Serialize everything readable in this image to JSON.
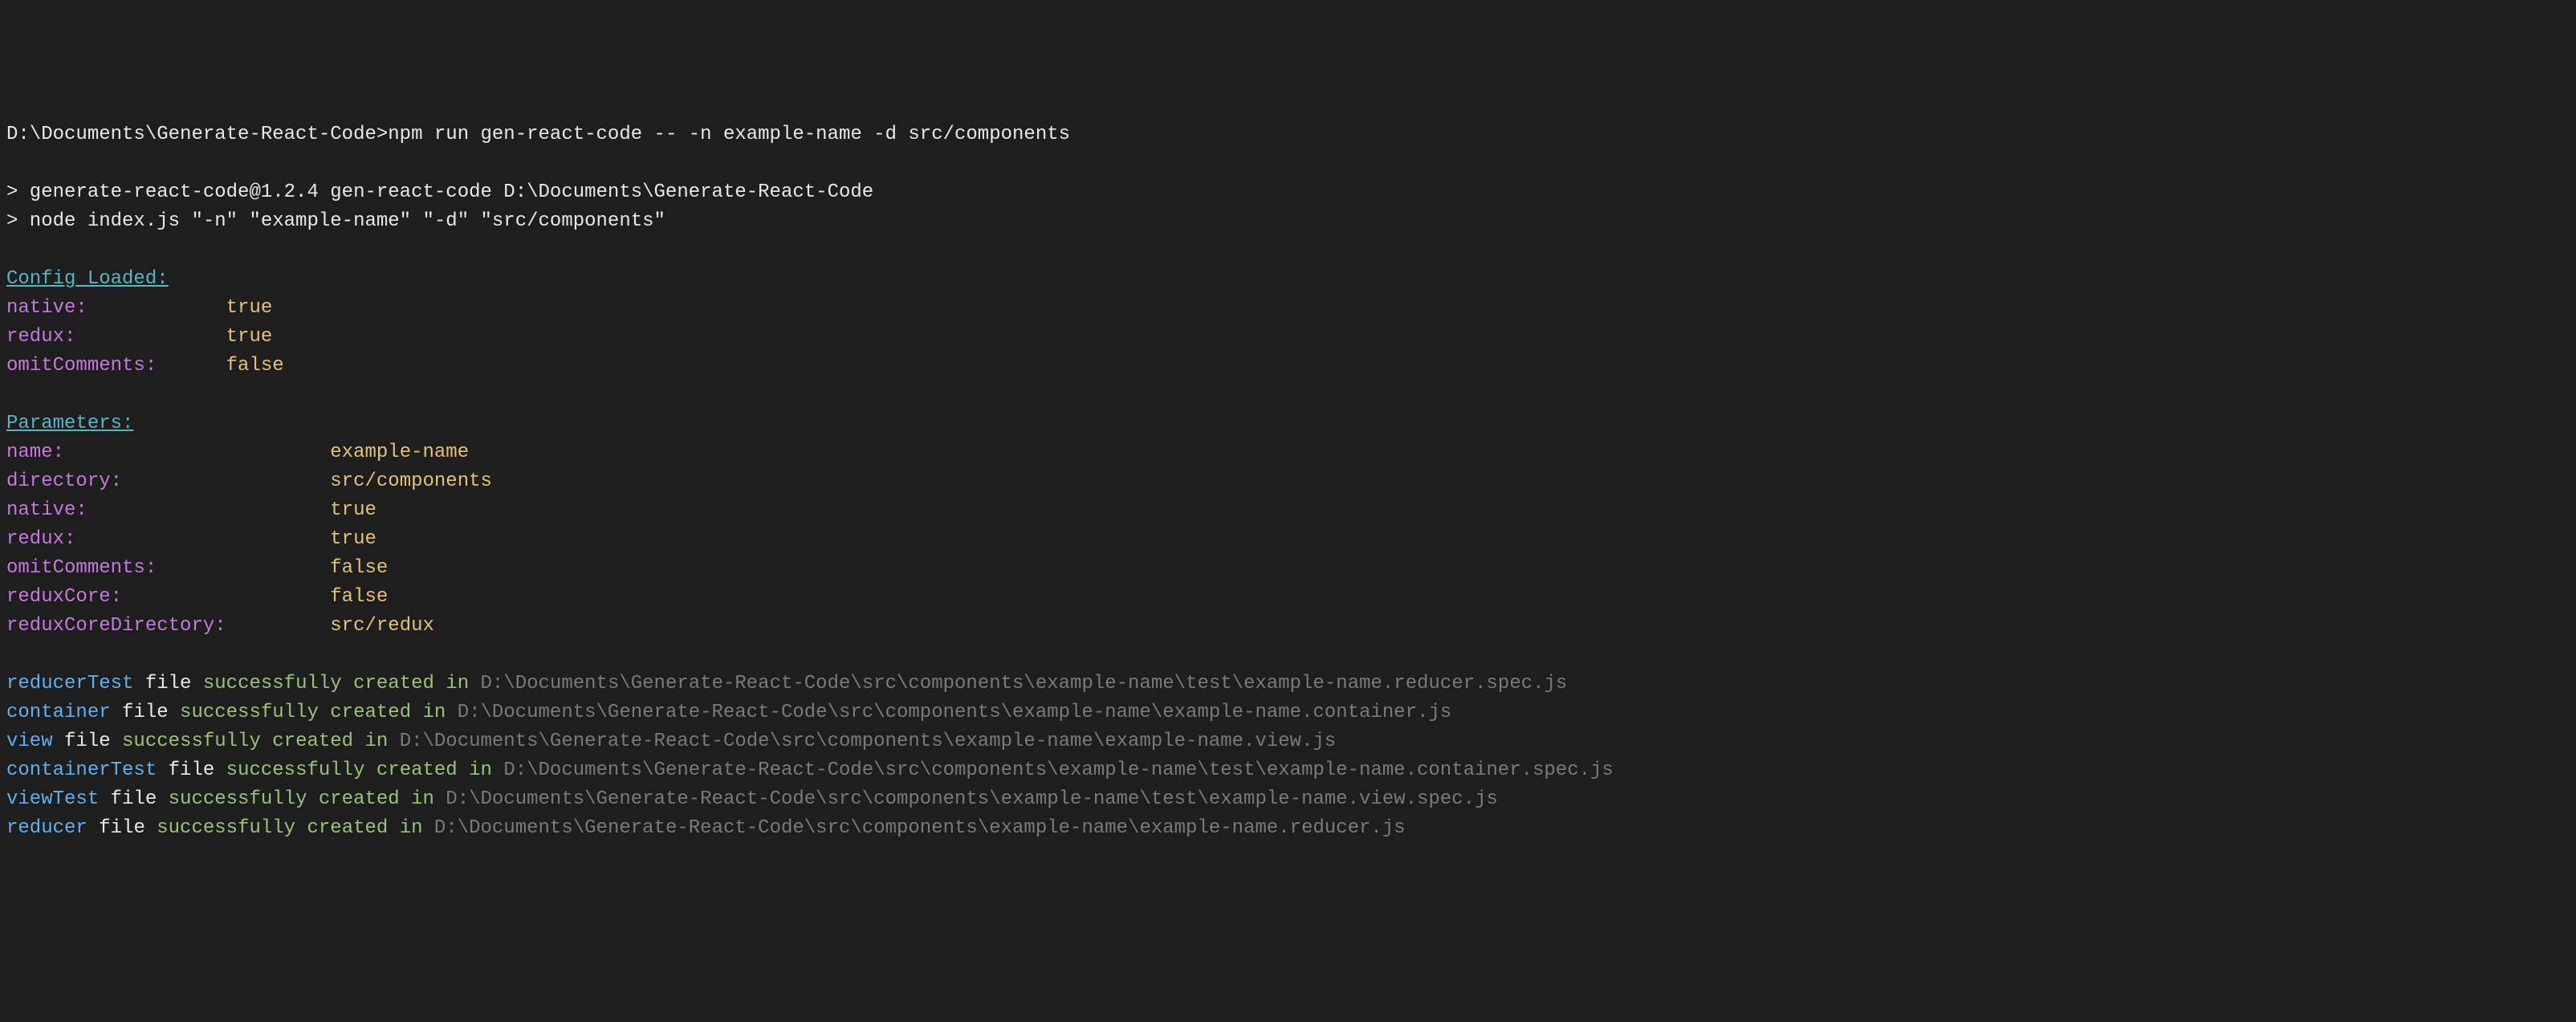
{
  "prompt": {
    "path": "D:\\Documents\\Generate-React-Code>",
    "command": "npm run gen-react-code -- -n example-name -d src/components"
  },
  "npm_output": {
    "line1": "> generate-react-code@1.2.4 gen-react-code D:\\Documents\\Generate-React-Code",
    "line2": "> node index.js \"-n\" \"example-name\" \"-d\" \"src/components\""
  },
  "config_section": {
    "header": "Config Loaded:",
    "items": [
      {
        "key": "native:",
        "value": "true",
        "pad": 12
      },
      {
        "key": "redux:",
        "value": "true",
        "pad": 13
      },
      {
        "key": "omitComments:",
        "value": "false",
        "pad": 6
      }
    ]
  },
  "params_section": {
    "header": "Parameters:",
    "items": [
      {
        "key": "name:",
        "value": "example-name",
        "pad": 23
      },
      {
        "key": "directory:",
        "value": "src/components",
        "pad": 18
      },
      {
        "key": "native:",
        "value": "true",
        "pad": 21
      },
      {
        "key": "redux:",
        "value": "true",
        "pad": 22
      },
      {
        "key": "omitComments:",
        "value": "false",
        "pad": 15
      },
      {
        "key": "reduxCore:",
        "value": "false",
        "pad": 18
      },
      {
        "key": "reduxCoreDirectory:",
        "value": "src/redux",
        "pad": 9
      }
    ]
  },
  "success_messages": [
    {
      "type": "reducerTest",
      "middle": " file ",
      "action": "successfully created in ",
      "path": "D:\\Documents\\Generate-React-Code\\src\\components\\example-name\\test\\example-name.reducer.spec.js"
    },
    {
      "type": "container",
      "middle": " file ",
      "action": "successfully created in ",
      "path": "D:\\Documents\\Generate-React-Code\\src\\components\\example-name\\example-name.container.js"
    },
    {
      "type": "view",
      "middle": " file ",
      "action": "successfully created in ",
      "path": "D:\\Documents\\Generate-React-Code\\src\\components\\example-name\\example-name.view.js"
    },
    {
      "type": "containerTest",
      "middle": " file ",
      "action": "successfully created in ",
      "path": "D:\\Documents\\Generate-React-Code\\src\\components\\example-name\\test\\example-name.container.spec.js"
    },
    {
      "type": "viewTest",
      "middle": " file ",
      "action": "successfully created in ",
      "path": "D:\\Documents\\Generate-React-Code\\src\\components\\example-name\\test\\example-name.view.spec.js"
    },
    {
      "type": "reducer",
      "middle": " file ",
      "action": "successfully created in ",
      "path": "D:\\Documents\\Generate-React-Code\\src\\components\\example-name\\example-name.reducer.js"
    }
  ]
}
